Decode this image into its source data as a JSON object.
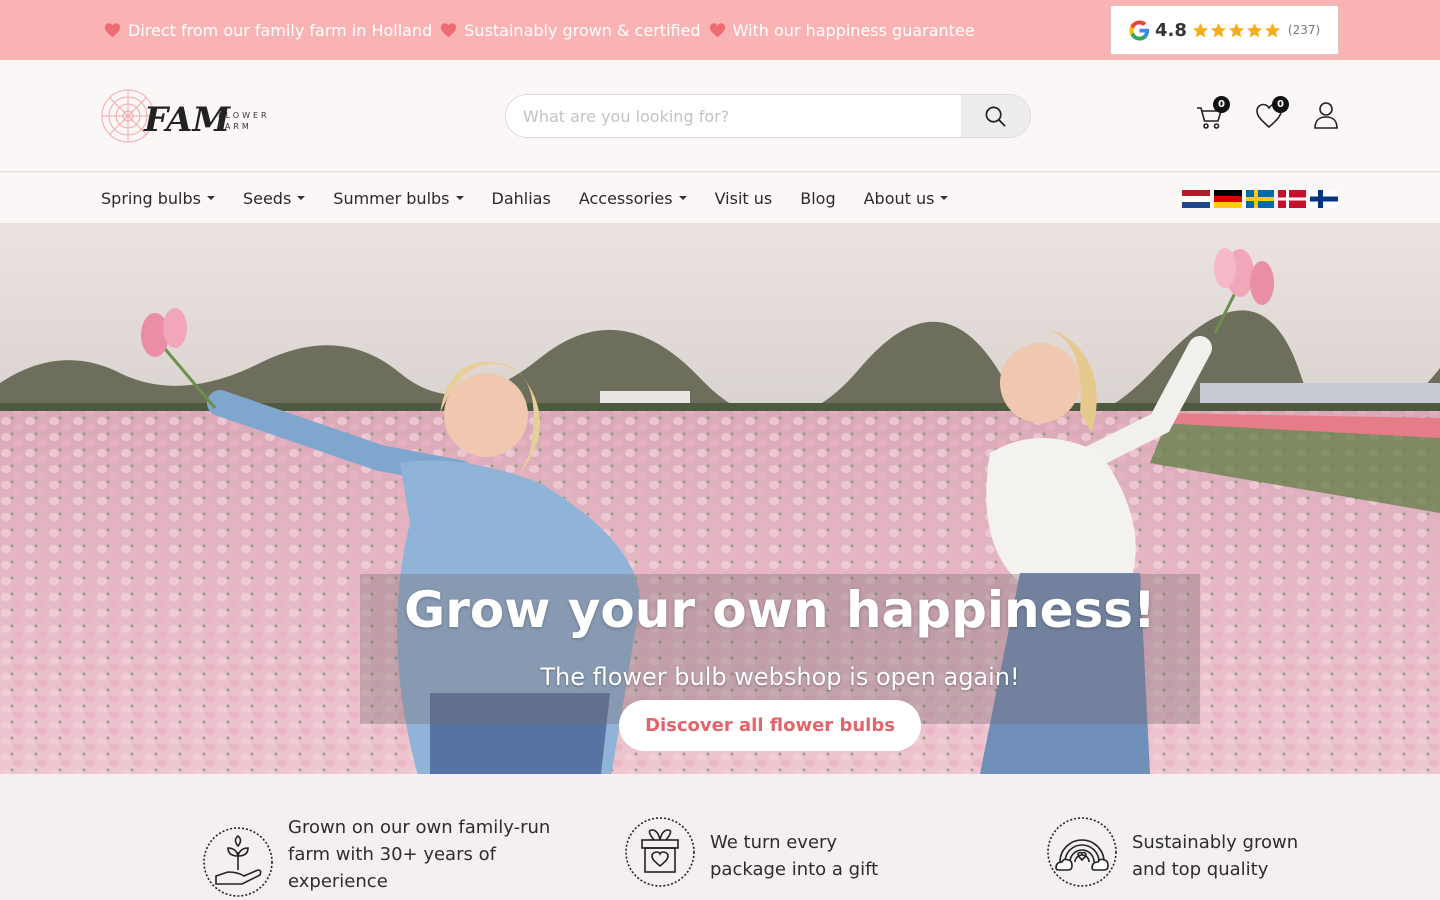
{
  "topbar": {
    "usps": [
      "Direct from our family farm in Holland",
      "Sustainably grown & certified",
      "With our happiness guarantee"
    ],
    "rating": {
      "score": "4.8",
      "stars": 5,
      "count": "(237)"
    }
  },
  "header": {
    "logo_text": "FAM",
    "logo_sub_1": "FLOWER",
    "logo_sub_2": "FARM",
    "search": {
      "placeholder": "What are you looking for?"
    },
    "cart_count": "0",
    "wishlist_count": "0"
  },
  "nav": {
    "items": [
      {
        "label": "Spring bulbs",
        "dropdown": true
      },
      {
        "label": "Seeds",
        "dropdown": true
      },
      {
        "label": "Summer bulbs",
        "dropdown": true
      },
      {
        "label": "Dahlias",
        "dropdown": false
      },
      {
        "label": "Accessories",
        "dropdown": true
      },
      {
        "label": "Visit us",
        "dropdown": false
      },
      {
        "label": "Blog",
        "dropdown": false
      },
      {
        "label": "About us",
        "dropdown": true
      }
    ],
    "flags": [
      "netherlands-flag-icon",
      "germany-flag-icon",
      "sweden-flag-icon",
      "denmark-flag-icon",
      "finland-flag-icon"
    ]
  },
  "hero": {
    "title": "Grow your own happiness!",
    "subtitle": "The flower bulb webshop is open again!",
    "cta": "Discover all flower bulbs"
  },
  "features": [
    {
      "icon": "hand-plant-icon",
      "lines": [
        "Grown on our own family-run",
        "farm with 30+ years of",
        "experience"
      ]
    },
    {
      "icon": "gift-box-icon",
      "lines": [
        "We turn every",
        "package into a gift"
      ]
    },
    {
      "icon": "rainbow-icon",
      "lines": [
        "Sustainably grown",
        "and top quality"
      ]
    }
  ],
  "colors": {
    "topbar": "#f9b3b3",
    "accent": "#e5636b",
    "header_bg": "#fcf7f7",
    "star": "#f2b01e"
  }
}
